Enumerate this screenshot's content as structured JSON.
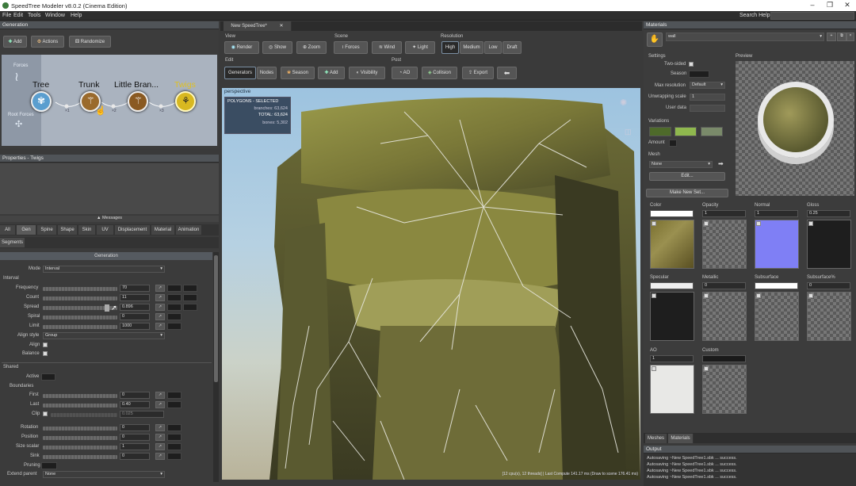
{
  "window": {
    "title": "SpeedTree Modeler v8.0.2 (Cinema Edition)"
  },
  "menu": [
    "File",
    "Edit",
    "Tools",
    "Window",
    "Help"
  ],
  "search_help_label": "Search Help:",
  "generation": {
    "header": "Generation",
    "buttons": {
      "add": "Add",
      "actions": "Actions",
      "randomize": "Randomize"
    },
    "side_labels": {
      "forces": "Forces",
      "root_forces": "Root Forces"
    },
    "nodes": [
      {
        "label": "Tree",
        "color": "#5a9ecf"
      },
      {
        "label": "Trunk",
        "color": "#9a6a2c"
      },
      {
        "label": "Little Bran...",
        "color": "#8a5a22"
      },
      {
        "label": "Twigs",
        "color": "#d8b820"
      }
    ],
    "link_labels": [
      "×1",
      "×2",
      "×3"
    ]
  },
  "properties": {
    "header": "Properties - Twigs",
    "messages": "Messages",
    "tabs": [
      "All",
      "Gen",
      "Spine",
      "Shape",
      "Skin",
      "UV",
      "Displacement",
      "Material",
      "Animation"
    ],
    "segments_tab": "Segments",
    "section": "Generation",
    "mode_label": "Mode",
    "mode_value": "Interval",
    "interval_label": "Interval",
    "interval_rows": [
      {
        "label": "Frequency",
        "value": "70"
      },
      {
        "label": "Count",
        "value": "11"
      },
      {
        "label": "Spread",
        "value": "0.896"
      },
      {
        "label": "Spiral",
        "value": "0"
      },
      {
        "label": "Limit",
        "value": "1000"
      }
    ],
    "align_style_label": "Align style",
    "align_style_value": "Group",
    "align_label": "Align",
    "balance_label": "Balance",
    "shared_label": "Shared",
    "active_label": "Active",
    "boundaries_label": "Boundaries",
    "boundary_rows": [
      {
        "label": "First",
        "value": "0"
      },
      {
        "label": "Last",
        "value": "0.40"
      },
      {
        "label": "Clip",
        "value": "0.025"
      }
    ],
    "other_rows": [
      {
        "label": "Rotation",
        "value": "0"
      },
      {
        "label": "Position",
        "value": "0"
      },
      {
        "label": "Size scalar",
        "value": "1"
      },
      {
        "label": "Sink",
        "value": "0"
      }
    ],
    "pruning_label": "Pruning",
    "extend_parent_label": "Extend parent",
    "extend_parent_value": "None"
  },
  "viewport": {
    "tab": "New SpeedTree*",
    "groups": {
      "view": "View",
      "scene": "Scene",
      "resolution": "Resolution",
      "edit": "Edit",
      "post": "Post"
    },
    "view_buttons": [
      "Render",
      "Show",
      "Zoom"
    ],
    "scene_buttons": [
      "Forces",
      "Wind",
      "Light"
    ],
    "resolution_buttons": [
      "High",
      "Medium",
      "Low",
      "Draft"
    ],
    "edit_buttons": [
      "Generators",
      "Nodes",
      "Season",
      "Add",
      "Visibility"
    ],
    "post_buttons": [
      "AO",
      "Collision",
      "Export"
    ],
    "camera": "perspective",
    "stats_title": "POLYGONS - SELECTED",
    "stats": [
      {
        "label": "branches:",
        "value": "63,624"
      },
      {
        "label": "TOTAL:",
        "value": "63,624"
      },
      {
        "label": "bones:",
        "value": "5,302"
      }
    ],
    "status": "[12 cpu(s), 12 threads] | Last Compute 141.17 ms (Draw to scene 176.41 ms)"
  },
  "materials": {
    "header": "Materials",
    "material_name": "wall",
    "settings_label": "Settings",
    "preview_label": "Preview",
    "two_sided_label": "Two-sided",
    "season_label": "Season",
    "max_res_label": "Max resolution",
    "max_res_value": "Default",
    "unwrap_label": "Unwrapping scale",
    "unwrap_value": "1",
    "user_data_label": "User data",
    "variations_label": "Variations",
    "variation_colors": [
      "#4e6a2a",
      "#8fb84e",
      "#7a8a6a"
    ],
    "amount_label": "Amount",
    "mesh_label": "Mesh",
    "mesh_value": "None",
    "edit_btn": "Edit...",
    "make_new_set_btn": "Make New Set...",
    "maps": [
      {
        "label": "Color",
        "value": ""
      },
      {
        "label": "Opacity",
        "value": "1"
      },
      {
        "label": "Normal",
        "value": "1"
      },
      {
        "label": "Gloss",
        "value": "0.25"
      },
      {
        "label": "Specular",
        "value": ""
      },
      {
        "label": "Metallic",
        "value": "0"
      },
      {
        "label": "Subsurface",
        "value": ""
      },
      {
        "label": "Subsurface%",
        "value": "0"
      },
      {
        "label": "AO",
        "value": "1"
      },
      {
        "label": "Custom",
        "value": ""
      }
    ],
    "bottom_tabs": [
      "Meshes",
      "Materials"
    ]
  },
  "output": {
    "header": "Output",
    "lines": [
      "Autosaving ~New SpeedTree1.sbk ... success.",
      "Autosaving ~New SpeedTree1.sbk ... success.",
      "Autosaving ~New SpeedTree1.sbk ... success.",
      "Autosaving ~New SpeedTree1.sbk ... success."
    ]
  }
}
